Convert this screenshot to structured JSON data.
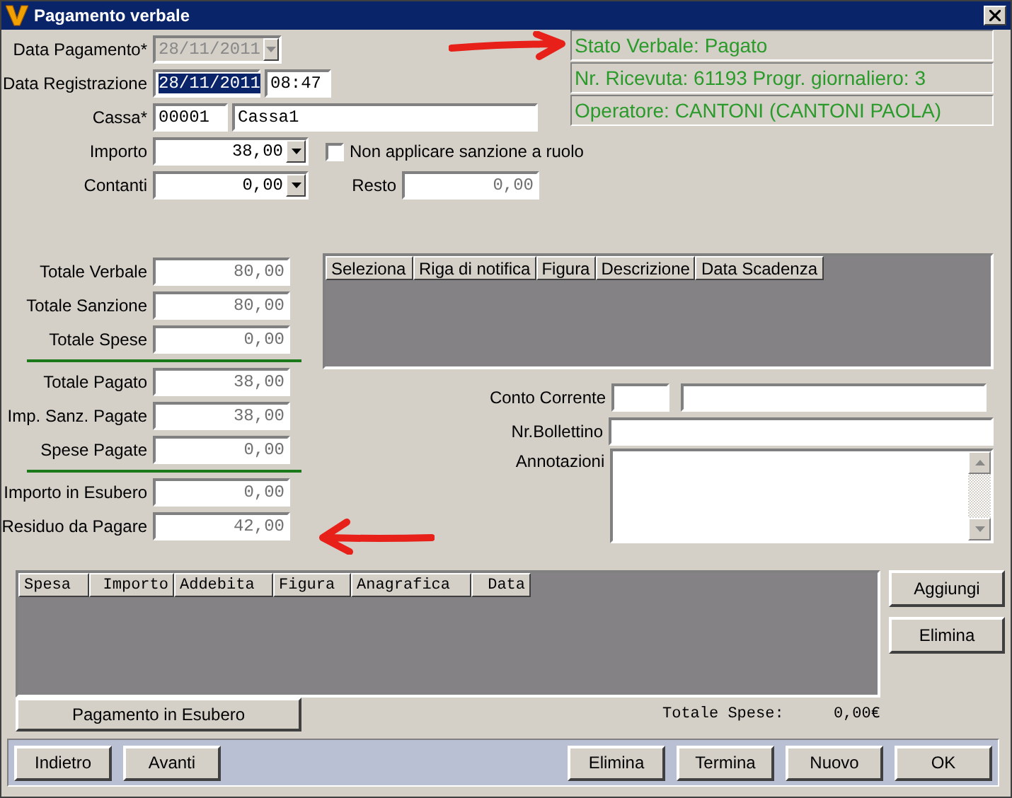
{
  "window": {
    "title": "Pagamento verbale"
  },
  "data_pagamento": {
    "label": "Data Pagamento*",
    "value": "28/11/2011",
    "disabled": true
  },
  "data_registrazione": {
    "label": "Data Registrazione",
    "date": "28/11/2011",
    "date_selected": true,
    "time": "08:47"
  },
  "cassa": {
    "label": "Cassa*",
    "code": "00001",
    "name": "Cassa1"
  },
  "importo": {
    "label": "Importo",
    "value": "38,00"
  },
  "non_applicare": {
    "label": "Non applicare sanzione a ruolo",
    "checked": false
  },
  "contanti": {
    "label": "Contanti",
    "value": "0,00"
  },
  "resto": {
    "label": "Resto",
    "value": "0,00"
  },
  "status": [
    "Stato Verbale: Pagato",
    "Nr. Ricevuta: 61193 Progr. giornaliero: 3",
    "Operatore: CANTONI (CANTONI PAOLA)"
  ],
  "totals": [
    [
      {
        "label": "Totale Verbale",
        "value": "80,00"
      },
      {
        "label": "Totale Sanzione",
        "value": "80,00"
      },
      {
        "label": "Totale Spese",
        "value": "0,00"
      }
    ],
    [
      {
        "label": "Totale Pagato",
        "value": "38,00"
      },
      {
        "label": "Imp. Sanz. Pagate",
        "value": "38,00"
      },
      {
        "label": "Spese Pagate",
        "value": "0,00"
      }
    ],
    [
      {
        "label": "Importo in Esubero",
        "value": "0,00"
      },
      {
        "label": "Residuo da Pagare",
        "value": "42,00"
      }
    ]
  ],
  "notifiche_table": {
    "columns": [
      "Seleziona",
      "Riga di notifica",
      "Figura",
      "Descrizione",
      "Data Scadenza"
    ]
  },
  "conto_corrente": {
    "label": "Conto Corrente"
  },
  "nr_bollettino": {
    "label": "Nr.Bollettino"
  },
  "annotazioni": {
    "label": "Annotazioni"
  },
  "spese_table": {
    "columns": [
      "Spesa",
      "Importo",
      "Addebita",
      "Figura",
      "Anagrafica",
      "Data"
    ]
  },
  "side_buttons": [
    "Aggiungi",
    "Elimina"
  ],
  "esubero_button": "Pagamento in Esubero",
  "totale_spese": {
    "label": "Totale Spese:",
    "value": "0,00€"
  },
  "footer_left": [
    "Indietro",
    "Avanti"
  ],
  "footer_right": [
    "Elimina",
    "Termina",
    "Nuovo",
    "OK"
  ]
}
